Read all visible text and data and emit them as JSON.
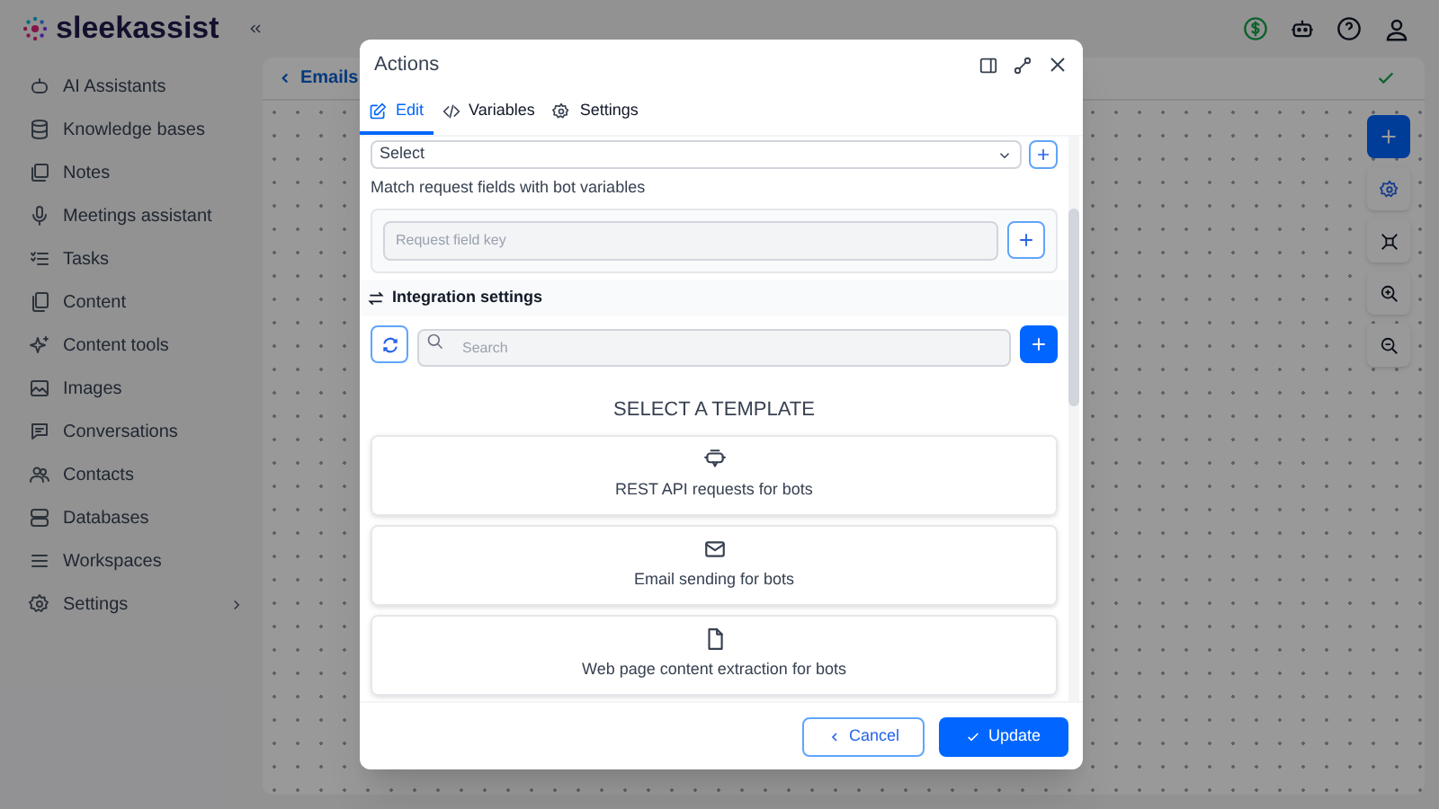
{
  "app": {
    "logo": "sleekassist"
  },
  "sidebar": {
    "items": [
      {
        "label": "AI Assistants",
        "kind": "link"
      },
      {
        "label": "Knowledge bases",
        "kind": "link"
      },
      {
        "label": "Notes",
        "kind": "link"
      },
      {
        "label": "Meetings assistant",
        "kind": "link"
      },
      {
        "label": "Tasks",
        "kind": "link"
      },
      {
        "label": "Content",
        "kind": "link"
      },
      {
        "label": "Content tools",
        "kind": "link"
      },
      {
        "label": "Images",
        "kind": "link"
      },
      {
        "label": "Conversations",
        "kind": "link"
      },
      {
        "label": "Contacts",
        "kind": "link"
      },
      {
        "label": "Databases",
        "kind": "link"
      },
      {
        "label": "Workspaces",
        "kind": "link"
      },
      {
        "label": "Settings",
        "kind": "group"
      }
    ]
  },
  "breadcrumb": {
    "label": "Emails"
  },
  "modal": {
    "title": "Actions",
    "tabs": [
      {
        "label": "Edit",
        "selected": true
      },
      {
        "label": "Variables",
        "selected": false
      },
      {
        "label": "Settings",
        "selected": false
      }
    ],
    "select": {
      "value": "Select"
    },
    "match_label": "Match request fields with bot variables",
    "request_field": {
      "placeholder": "Request field key"
    },
    "integration_title": "Integration settings",
    "search": {
      "placeholder": "Search"
    },
    "template_heading": "SELECT A TEMPLATE",
    "templates": [
      {
        "label": "REST API requests for bots"
      },
      {
        "label": "Email sending for bots"
      },
      {
        "label": "Web page content extraction for bots"
      }
    ],
    "buttons": [
      {
        "label": "Cancel",
        "kind": "secondary"
      },
      {
        "label": "Update",
        "kind": "primary"
      }
    ]
  }
}
